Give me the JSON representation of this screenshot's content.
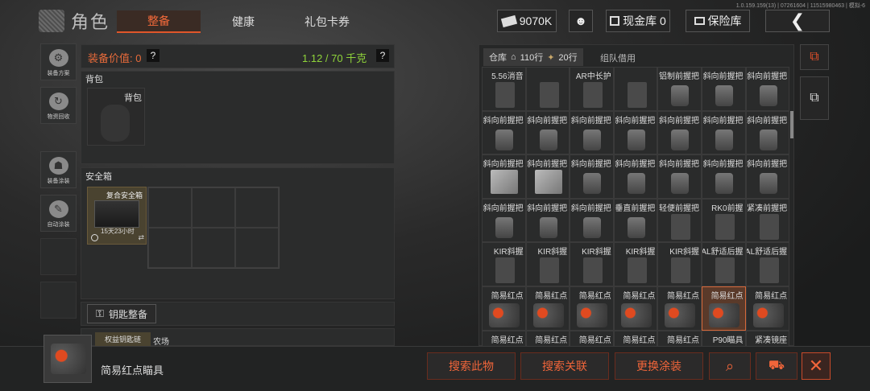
{
  "version_text": "1.0.159.159(13) | 07261604 | 11515980463 | 模拟-6",
  "header": {
    "title": "角色",
    "tabs": [
      {
        "label": "整备",
        "active": true
      },
      {
        "label": "健康",
        "active": false
      },
      {
        "label": "礼包卡券",
        "active": false
      }
    ],
    "money": "9070K",
    "cash_vault": "现金库 0",
    "insurance": "保险库",
    "back_icon": "chevron-left-icon"
  },
  "sidebar": [
    {
      "label": "装备方案",
      "icon": "gear-kit-icon"
    },
    {
      "label": "物资回收",
      "icon": "recycle-icon"
    },
    {
      "label": "装备涂装",
      "icon": "helmet-icon"
    },
    {
      "label": "自动涂装",
      "icon": "spray-icon"
    }
  ],
  "equipment": {
    "value_label": "装备价值: 0",
    "help": "?",
    "weight": "1.12 / 70 千克",
    "backpack_section": "背包",
    "backpack_slot": "背包",
    "safebox_section": "安全箱",
    "safebox_name": "复合安全箱",
    "safebox_timer": "15天23小时",
    "key_button": "钥匙整备",
    "bottom_tag": "权益钥匙链",
    "bottom_tag2": "农场"
  },
  "inventory": {
    "tab_warehouse": "仓库",
    "rows_a": "110行",
    "rows_b": "20行",
    "tab_team": "组队借用",
    "items": [
      {
        "name": "5.56消音",
        "type": "k"
      },
      {
        "name": "",
        "type": "k"
      },
      {
        "name": "AR中长护",
        "type": "k"
      },
      {
        "name": "",
        "type": "k"
      },
      {
        "name": "铝制前握把",
        "type": "g"
      },
      {
        "name": "斜向前握把",
        "type": "g"
      },
      {
        "name": "斜向前握把",
        "type": "g"
      },
      {
        "name": "斜向前握把",
        "type": "g"
      },
      {
        "name": "斜向前握把",
        "type": "g"
      },
      {
        "name": "斜向前握把",
        "type": "g"
      },
      {
        "name": "斜向前握把",
        "type": "g"
      },
      {
        "name": "斜向前握把",
        "type": "g"
      },
      {
        "name": "斜向前握把",
        "type": "g"
      },
      {
        "name": "斜向前握把",
        "type": "g"
      },
      {
        "name": "斜向前握把",
        "type": "s"
      },
      {
        "name": "斜向前握把",
        "type": "s"
      },
      {
        "name": "斜向前握把",
        "type": "g"
      },
      {
        "name": "斜向前握把",
        "type": "g"
      },
      {
        "name": "斜向前握把",
        "type": "g"
      },
      {
        "name": "斜向前握把",
        "type": "g"
      },
      {
        "name": "斜向前握把",
        "type": "g"
      },
      {
        "name": "斜向前握把",
        "type": "g"
      },
      {
        "name": "斜向前握把",
        "type": "g"
      },
      {
        "name": "斜向前握把",
        "type": "g"
      },
      {
        "name": "垂直前握把",
        "type": "g"
      },
      {
        "name": "轻便前握把",
        "type": "k"
      },
      {
        "name": "RK0前握",
        "type": "k"
      },
      {
        "name": "紧凑前握把",
        "type": "k"
      },
      {
        "name": "KIR斜握",
        "type": "k"
      },
      {
        "name": "KIR斜握",
        "type": "k"
      },
      {
        "name": "KIR斜握",
        "type": "k"
      },
      {
        "name": "KIR斜握",
        "type": "k"
      },
      {
        "name": "KIR斜握",
        "type": "k"
      },
      {
        "name": "FAL舒适后握",
        "type": "k"
      },
      {
        "name": "FAL舒适后握",
        "type": "k"
      },
      {
        "name": "简易红点",
        "type": "r"
      },
      {
        "name": "简易红点",
        "type": "r"
      },
      {
        "name": "简易红点",
        "type": "r"
      },
      {
        "name": "简易红点",
        "type": "r"
      },
      {
        "name": "简易红点",
        "type": "r"
      },
      {
        "name": "简易红点",
        "type": "r",
        "selected": true
      },
      {
        "name": "简易红点",
        "type": "r"
      },
      {
        "name": "简易红点",
        "type": "r"
      },
      {
        "name": "简易红点",
        "type": "r"
      },
      {
        "name": "简易红点",
        "type": "r"
      },
      {
        "name": "简易红点",
        "type": "r"
      },
      {
        "name": "简易红点",
        "type": "r"
      },
      {
        "name": "P90瞄具",
        "type": "k"
      },
      {
        "name": "紧凑镜座",
        "type": "k"
      }
    ]
  },
  "selected_item": "简易红点瞄具",
  "actions": {
    "search_here": "搜索此物",
    "search_related": "搜索关联",
    "change_skin": "更换涂装"
  }
}
